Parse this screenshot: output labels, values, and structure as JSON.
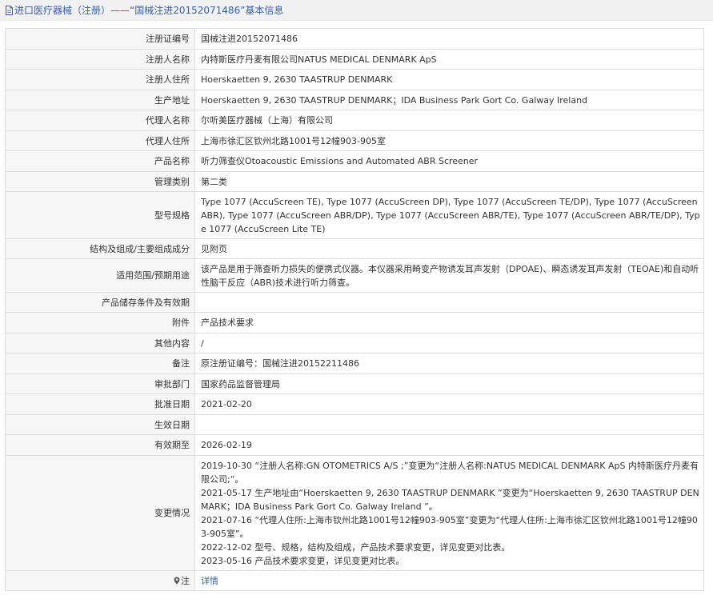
{
  "header": {
    "title": "进口医疗器械（注册）——“国械注进20152071486”基本信息"
  },
  "rows": [
    {
      "label": "注册证编号",
      "value": "国械注进20152071486"
    },
    {
      "label": "注册人名称",
      "value": "内特斯医疗丹麦有限公司NATUS MEDICAL DENMARK ApS"
    },
    {
      "label": "注册人住所",
      "value": "Hoerskaetten 9, 2630 TAASTRUP DENMARK"
    },
    {
      "label": "生产地址",
      "value": "Hoerskaetten 9, 2630 TAASTRUP DENMARK；IDA Business Park Gort Co. Galway Ireland"
    },
    {
      "label": "代理人名称",
      "value": "尔听美医疗器械（上海）有限公司"
    },
    {
      "label": "代理人住所",
      "value": "上海市徐汇区钦州北路1001号12幢903-905室"
    },
    {
      "label": "产品名称",
      "value": "听力筛查仪Otoacoustic Emissions and Automated ABR Screener"
    },
    {
      "label": "管理类别",
      "value": "第二类"
    },
    {
      "label": "型号规格",
      "value": "Type 1077 (AccuScreen TE), Type 1077 (AccuScreen DP), Type 1077 (AccuScreen TE/DP), Type 1077 (AccuScreen ABR), Type 1077 (AccuScreen ABR/DP), Type 1077 (AccuScreen ABR/TE), Type 1077 (AccuScreen ABR/TE/DP), Type 1077 (AccuScreen Lite TE)"
    },
    {
      "label": "结构及组成/主要组成成分",
      "value": "见附页"
    },
    {
      "label": "适用范围/预期用途",
      "value": "该产品是用于筛查听力损失的便携式仪器。本仪器采用畸变产物诱发耳声发射（DPOAE)、瞬态诱发耳声发射（TEOAE)和自动听性脑干反应（ABR)技术进行听力筛查。"
    },
    {
      "label": "产品储存条件及有效期",
      "value": ""
    },
    {
      "label": "附件",
      "value": "产品技术要求"
    },
    {
      "label": "其他内容",
      "value": "/"
    },
    {
      "label": "备注",
      "value": "原注册证编号：国械注进20152211486"
    },
    {
      "label": "审批部门",
      "value": "国家药品监督管理局"
    },
    {
      "label": "批准日期",
      "value": "2021-02-20"
    },
    {
      "label": "生效日期",
      "value": ""
    },
    {
      "label": "有效期至",
      "value": "2026-02-19"
    }
  ],
  "changes": {
    "label": "变更情况",
    "entries": [
      "2019-10-30 “注册人名称:GN OTOMETRICS A/S ;”变更为“注册人名称:NATUS MEDICAL DENMARK ApS 内特斯医疗丹麦有限公司;”。",
      "2021-05-17 生产地址由“Hoerskaetten 9, 2630 TAASTRUP DENMARK ”变更为“Hoerskaetten 9, 2630 TAASTRUP DENMARK；IDA Business Park Gort Co. Galway Ireland ”。",
      "2021-07-16 “代理人住所:上海市钦州北路1001号12幢903-905室”变更为“代理人住所:上海市徐汇区钦州北路1001号12幢903-905室”。",
      "2022-12-02 型号、规格，结构及组成，产品技术要求变更，详见变更对比表。",
      "2023-05-16 产品技术要求变更，详见变更对比表。"
    ]
  },
  "note": {
    "label": "注",
    "link_text": "详情",
    "icon": "map-pin-icon"
  },
  "colors": {
    "title_text": "#3960a8",
    "label_bg": "#f6f6f6",
    "border": "#dddddd",
    "link": "#3960a8"
  }
}
